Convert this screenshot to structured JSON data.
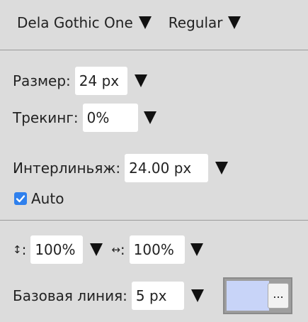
{
  "font_selector": {
    "family": "Dela Gothic One",
    "style": "Regular"
  },
  "size": {
    "label": "Размер:",
    "value": "24 px"
  },
  "tracking": {
    "label": "Трекинг:",
    "value": "0%"
  },
  "leading": {
    "label": "Интерлиньяж:",
    "value": "24.00 px",
    "auto_label": "Auto",
    "auto_checked": true
  },
  "scale": {
    "vertical_icon": "↕",
    "vertical_value": "100%",
    "horizontal_icon": "↔",
    "horizontal_value": "100%",
    "icon_suffix": ":"
  },
  "baseline": {
    "label": "Базовая линия:",
    "value": "5 px"
  },
  "color_swatch": {
    "color": "#c8d4f8",
    "more_label": "..."
  }
}
